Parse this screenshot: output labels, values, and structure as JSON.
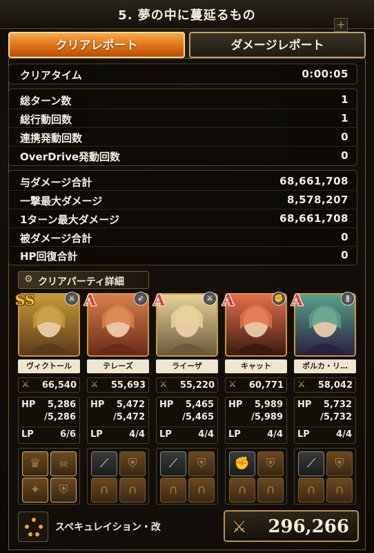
{
  "header": {
    "title": "5. 夢の中に蔓延るもの",
    "plus_label": "+"
  },
  "tabs": [
    {
      "label": "クリアレポート",
      "active": true
    },
    {
      "label": "ダメージレポート",
      "active": false
    }
  ],
  "clear_time": {
    "label": "クリアタイム",
    "value": "0:00:05"
  },
  "turn_stats": [
    {
      "label": "総ターン数",
      "value": "1"
    },
    {
      "label": "総行動回数",
      "value": "1"
    },
    {
      "label": "連携発動回数",
      "value": "0"
    },
    {
      "label": "OverDrive発動回数",
      "value": "0"
    }
  ],
  "damage_stats": [
    {
      "label": "与ダメージ合計",
      "value": "68,661,708"
    },
    {
      "label": "一撃最大ダメージ",
      "value": "8,578,207"
    },
    {
      "label": "1ターン最大ダメージ",
      "value": "68,661,708"
    },
    {
      "label": "被ダメージ合計",
      "value": "0"
    },
    {
      "label": "HP回復合計",
      "value": "0"
    }
  ],
  "party": {
    "header": "クリアパーティ詳細",
    "members": [
      {
        "name": "ヴィクトール",
        "rank": "SS",
        "weapon_icon": "sword-icon",
        "power": "66,540",
        "hp": "5,286",
        "hp_max": "/5,286",
        "lp": "6/6",
        "colors": [
          "#c69a3a",
          "#5a3a1a"
        ]
      },
      {
        "name": "テレーズ",
        "rank": "A",
        "weapon_icon": "bow-icon",
        "power": "55,693",
        "hp": "5,472",
        "hp_max": "/5,472",
        "lp": "4/4",
        "colors": [
          "#d8804a",
          "#6a2a1a"
        ]
      },
      {
        "name": "ライーザ",
        "rank": "A",
        "weapon_icon": "sword-icon",
        "power": "55,220",
        "hp": "5,465",
        "hp_max": "/5,465",
        "lp": "4/4",
        "colors": [
          "#e8d29a",
          "#6a5a3a"
        ]
      },
      {
        "name": "キャット",
        "rank": "A",
        "weapon_icon": "fist-icon",
        "power": "60,771",
        "hp": "5,989",
        "hp_max": "/5,989",
        "lp": "4/4",
        "colors": [
          "#e2704a",
          "#3a1a10"
        ]
      },
      {
        "name": "ポルカ・リ…",
        "rank": "A",
        "weapon_icon": "staff-icon",
        "power": "58,042",
        "hp": "5,732",
        "hp_max": "/5,732",
        "lp": "4/4",
        "colors": [
          "#5aa08a",
          "#2a2040"
        ]
      }
    ],
    "stat_labels": {
      "hp": "HP",
      "lp": "LP"
    }
  },
  "footer": {
    "formation_name": "スペキュレイション・改",
    "total_power": "296,266"
  },
  "colors": {
    "accent": "#e27a1c",
    "gold": "#c89a3e"
  }
}
